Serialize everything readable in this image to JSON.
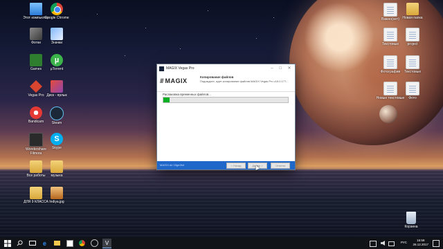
{
  "desktop": {
    "left_icons": [
      {
        "label": "Этот компьютер",
        "icon": "computer-icon"
      },
      {
        "label": "Google Chrome",
        "icon": "chrome-icon"
      },
      {
        "label": "Фотки",
        "icon": "photos-icon"
      },
      {
        "label": "Значки",
        "icon": "icons-folder-icon"
      },
      {
        "label": "Games",
        "icon": "games-icon"
      },
      {
        "label": "µTorrent",
        "icon": "utorrent-icon"
      },
      {
        "label": "Vegas Pro",
        "icon": "vegas-icon"
      },
      {
        "label": "Диск - ярлык",
        "icon": "drive-shortcut-icon"
      },
      {
        "label": "Bandicam",
        "icon": "bandicam-icon"
      },
      {
        "label": "Steam",
        "icon": "steam-icon"
      },
      {
        "label": "Wondershare Filmora",
        "icon": "filmora-icon"
      },
      {
        "label": "Skype",
        "icon": "skype-icon"
      },
      {
        "label": "Все работы",
        "icon": "folder-icon"
      },
      {
        "label": "музыка",
        "icon": "folder-icon"
      },
      {
        "label": "ДЛЯ 9 КЛАССА",
        "icon": "folder-icon"
      },
      {
        "label": "Indiya.jpg",
        "icon": "image-file-icon"
      }
    ],
    "right_icons": [
      {
        "label": "Важно(нет)",
        "icon": "document-icon"
      },
      {
        "label": "Новая папка",
        "icon": "folder-icon"
      },
      {
        "label": "Текстовые",
        "icon": "document-icon"
      },
      {
        "label": "project",
        "icon": "document-icon"
      },
      {
        "label": "Фотографии",
        "icon": "document-icon"
      },
      {
        "label": "Текстовые",
        "icon": "document-icon"
      },
      {
        "label": "Новые текстовые",
        "icon": "document-icon"
      },
      {
        "label": "Фото",
        "icon": "document-icon"
      },
      {
        "label": "Корзина",
        "icon": "recycle-bin-icon"
      }
    ]
  },
  "installer": {
    "window_title": "MAGIX Vegas Pro",
    "logo_text": "MAGIX",
    "heading": "Копирование файлов",
    "subheading": "Подождите, идет копирование файлов MAGIX Vegas Pro v15.0.177...",
    "progress_label": "Распаковка временных файлов...",
    "progress_fraction": 0.05,
    "footer_text": "MAGIX.de 15ge2b4",
    "buttons": {
      "back": "< Назад",
      "next": "Далее >",
      "cancel": "Отмена"
    }
  },
  "taskbar": {
    "language": "РУС",
    "time": "15:59",
    "date": "26.12.2017"
  }
}
